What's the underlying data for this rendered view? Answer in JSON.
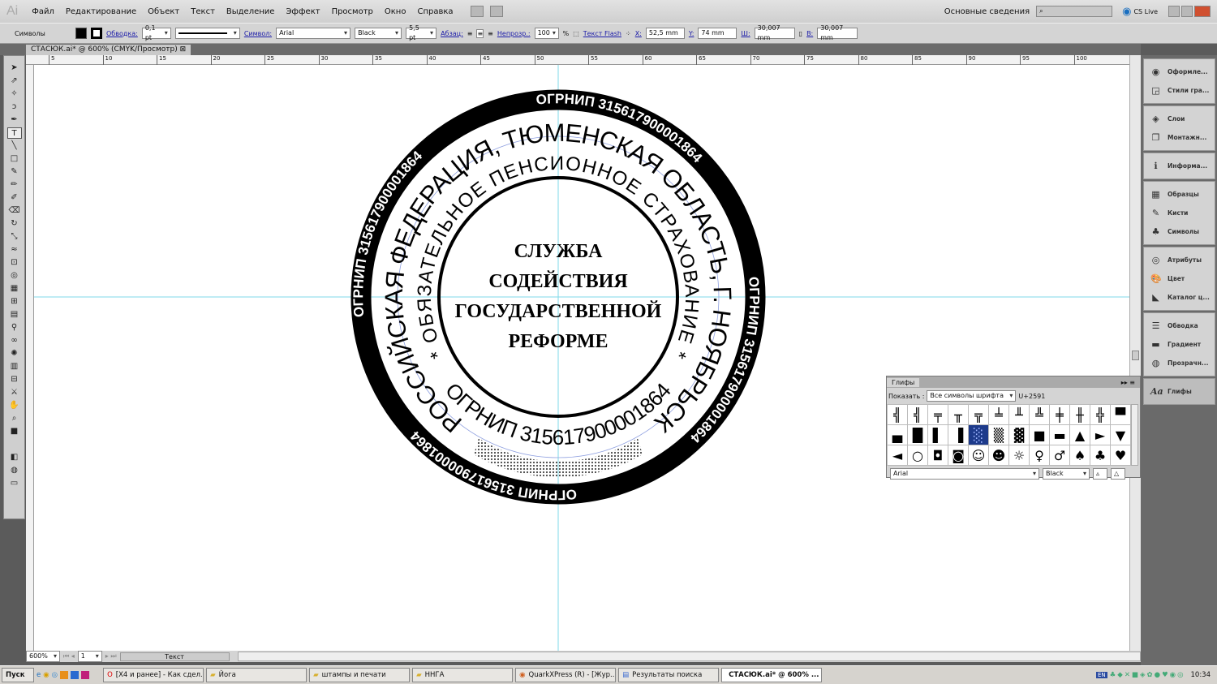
{
  "app": {
    "logo": "Ai",
    "menu": [
      "Файл",
      "Редактирование",
      "Объект",
      "Текст",
      "Выделение",
      "Эффект",
      "Просмотр",
      "Окно",
      "Справка"
    ],
    "workspace": "Основные сведения",
    "cs_live": "CS Live"
  },
  "control": {
    "mode": "Символы",
    "stroke_label": "Обводка:",
    "stroke_value": "0,1 pt",
    "char_label": "Символ:",
    "font": "Arial",
    "style": "Black",
    "size": "5,5 pt",
    "para_label": "Абзац:",
    "opacity_label": "Непрозр.:",
    "opacity": "100",
    "pct": "%",
    "flash_label": "Текст Flash",
    "x_label": "X:",
    "x": "52,5 mm",
    "y_label": "Y:",
    "y": "74 mm",
    "w_label": "Ш:",
    "w": "30,007 mm",
    "h_label": "В:",
    "h": "30,007 mm"
  },
  "document": {
    "tab": "СТАСЮК.ai* @ 600% (CMYK/Просмотр)"
  },
  "ruler": [
    "5",
    "10",
    "15",
    "20",
    "25",
    "30",
    "35",
    "40",
    "45",
    "50",
    "55",
    "60",
    "65",
    "70",
    "75",
    "80",
    "85",
    "90",
    "95",
    "100"
  ],
  "stamp": {
    "outer_ring": [
      "ОГРНИП 315617900001864",
      "ОГРНИП 315617900001864",
      "ОГРНИП 315617900001864",
      "ОГРНИП 315617900001864"
    ],
    "middle_ring": "РОССИЙСКАЯ ФЕДЕРАЦИЯ, ТЮМЕНСКАЯ ОБЛАСТЬ, Г. НОЯБРЬСК",
    "inner_top": "* ОБЯЗАТЕЛЬНОЕ ПЕНСИОННОЕ СТРАХОВАНИЕ *",
    "inner_bottom": "ОГРНИП 315617900001864",
    "center": [
      "СЛУЖБА",
      "СОДЕЙСТВИЯ",
      "ГОСУДАРСТВЕННОЙ",
      "РЕФОРМЕ"
    ]
  },
  "status": {
    "zoom": "600%",
    "page": "1",
    "info": "Текст"
  },
  "panels": [
    [
      "Оформле...",
      " Стили гра..."
    ],
    [
      "Слои",
      "Монтажн..."
    ],
    [
      "Информа..."
    ],
    [
      "Образцы",
      "Кисти",
      "Символы"
    ],
    [
      "Атрибуты",
      "Цвет",
      "Каталог ц..."
    ],
    [
      "Обводка",
      "Градиент",
      "Прозрачн..."
    ],
    [
      "Глифы"
    ]
  ],
  "glyphs": {
    "title": "Глифы",
    "show_label": "Показать :",
    "show_value": "Все символы шрифта",
    "code": "U+2591",
    "font": "Arial",
    "style": "Black",
    "cells": [
      "╣",
      "╣",
      "╤",
      "╥",
      "╦",
      "╧",
      "╨",
      "╩",
      "╪",
      "╫",
      "╬",
      "▀",
      "▄",
      "█",
      "▌",
      "▐",
      "░",
      "▒",
      "▓",
      "■",
      "▬",
      "▲",
      "►",
      "▼",
      "◄",
      "○",
      "◘",
      "◙",
      "☺",
      "☻",
      "☼",
      "♀",
      "♂",
      "♠",
      "♣",
      "♥"
    ]
  },
  "taskbar": {
    "start": "Пуск",
    "items": [
      "[X4 и ранее] - Как сдел...",
      "Йога",
      "штампы и печати",
      "ННГА",
      "QuarkXPress (R) - [Жур...",
      "Результаты поиска",
      "СТАСЮК.ai* @ 600% ..."
    ],
    "lang": "EN",
    "clock": "10:34"
  }
}
